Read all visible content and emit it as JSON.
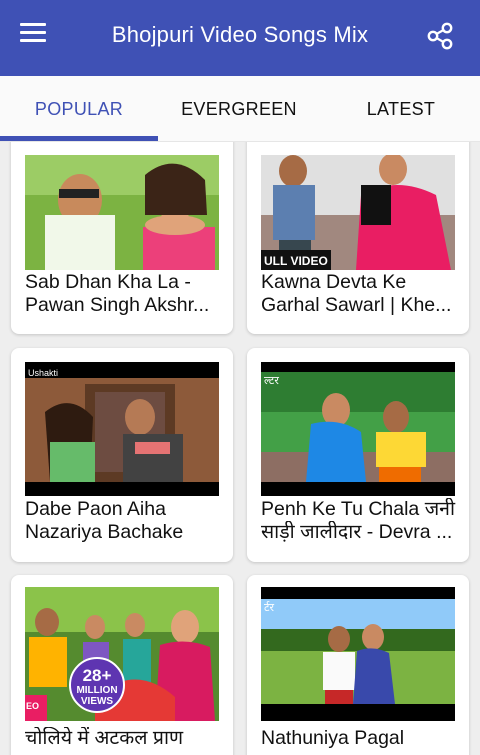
{
  "appbar": {
    "title": "Bhojpuri Video Songs Mix",
    "menu_icon": "hamburger-menu-icon",
    "share_icon": "share-icon",
    "color": "#3f51b5"
  },
  "tabs": [
    {
      "label": "POPULAR",
      "active": true
    },
    {
      "label": "EVERGREEN",
      "active": false
    },
    {
      "label": "LATEST",
      "active": false
    }
  ],
  "videos": [
    {
      "line1": "Sab Dhan Kha La -",
      "line2": "Pawan Singh Akshr..."
    },
    {
      "line1": "Kawna Devta Ke",
      "line2": "Garhal Sawarl | Khe...",
      "thumb_text": "ULL VIDEO"
    },
    {
      "line1": "Dabe Paon Aiha",
      "line2": "Nazariya Bachake",
      "thumb_text": "Ushakti"
    },
    {
      "line1": "Penh Ke Tu Chala जनी",
      "line2": "साड़ी जालीदार - Devra ...",
      "thumb_text": "ल्टर"
    },
    {
      "line1": "चोलिये में अटकल प्राण",
      "line2": "",
      "badge_top": "28+",
      "badge_mid": "MILLION",
      "badge_bot": "VIEWS",
      "corner_text": "EO"
    },
    {
      "line1": "Nathuniya Pagal",
      "line2": "",
      "thumb_text": "र्टर"
    }
  ]
}
